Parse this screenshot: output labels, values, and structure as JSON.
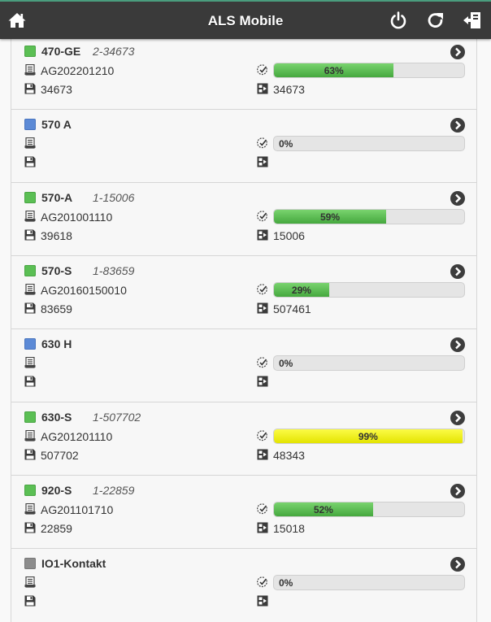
{
  "app": {
    "title": "ALS Mobile",
    "header_color": "#3a3a3a",
    "icons": [
      "home-icon",
      "power-icon",
      "refresh-icon",
      "logout-icon"
    ]
  },
  "items": [
    {
      "status": "green",
      "name": "470-GE",
      "subtitle": "2-34673",
      "order": "AG202201210",
      "number": "34673",
      "progress": 63,
      "progress_label": "63%",
      "count": "34673"
    },
    {
      "status": "blue",
      "name": "570 A",
      "subtitle": "",
      "order": "",
      "number": "",
      "progress": 0,
      "progress_label": "0%",
      "count": ""
    },
    {
      "status": "green",
      "name": "570-A",
      "subtitle": "1-15006",
      "order": "AG201001110",
      "number": "39618",
      "progress": 59,
      "progress_label": "59%",
      "count": "15006"
    },
    {
      "status": "green",
      "name": "570-S",
      "subtitle": "1-83659",
      "order": "AG20160150010",
      "number": "83659",
      "progress": 29,
      "progress_label": "29%",
      "count": "507461"
    },
    {
      "status": "blue",
      "name": "630 H",
      "subtitle": "",
      "order": "",
      "number": "",
      "progress": 0,
      "progress_label": "0%",
      "count": ""
    },
    {
      "status": "green",
      "name": "630-S",
      "subtitle": "1-507702",
      "order": "AG201201110",
      "number": "507702",
      "progress": 99,
      "progress_label": "99%",
      "count": "48343",
      "bar_color": "yellow"
    },
    {
      "status": "green",
      "name": "920-S",
      "subtitle": "1-22859",
      "order": "AG201101710",
      "number": "22859",
      "progress": 52,
      "progress_label": "52%",
      "count": "15018"
    },
    {
      "status": "gray",
      "name": "IO1-Kontakt",
      "subtitle": "",
      "order": "",
      "number": "",
      "progress": 0,
      "progress_label": "0%",
      "count": ""
    }
  ],
  "colors": {
    "green": "#5bbf54",
    "blue": "#5c8ad6",
    "gray": "#8c8c8c",
    "bar_green": "#45a83e",
    "bar_yellow": "#f0f000"
  }
}
